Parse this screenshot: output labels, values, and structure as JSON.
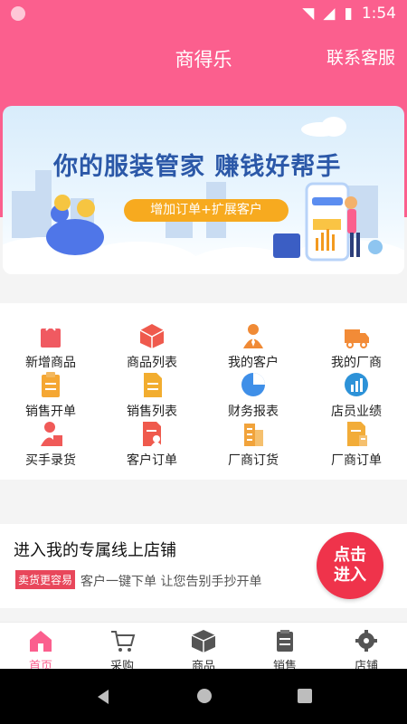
{
  "status_bar": {
    "time": "1:54"
  },
  "header": {
    "title": "商得乐",
    "service": "联系客服"
  },
  "banner": {
    "headline": "你的服装管家 赚钱好帮手",
    "pill": "增加订单+扩展客户"
  },
  "menu": [
    {
      "label": "新增商品",
      "icon": "shopping-bag-icon",
      "color": "#f05a61"
    },
    {
      "label": "商品列表",
      "icon": "package-icon",
      "color": "#ef5a4d"
    },
    {
      "label": "我的客户",
      "icon": "customer-icon",
      "color": "#f08a35"
    },
    {
      "label": "我的厂商",
      "icon": "truck-icon",
      "color": "#f28b37"
    },
    {
      "label": "销售开单",
      "icon": "clipboard-icon",
      "color": "#f5a733"
    },
    {
      "label": "销售列表",
      "icon": "document-icon",
      "color": "#f2ad2f"
    },
    {
      "label": "财务报表",
      "icon": "pie-chart-icon",
      "color": "#3f8fe8"
    },
    {
      "label": "店员业绩",
      "icon": "performance-chart-icon",
      "color": "#2d92d8"
    },
    {
      "label": "买手录货",
      "icon": "buyer-bag-icon",
      "color": "#f05a58"
    },
    {
      "label": "客户订单",
      "icon": "customer-order-icon",
      "color": "#ef5a4d"
    },
    {
      "label": "厂商订货",
      "icon": "vendor-building-icon",
      "color": "#f1a33b"
    },
    {
      "label": "厂商订单",
      "icon": "vendor-order-icon",
      "color": "#f2ac38"
    }
  ],
  "promo": {
    "title": "进入我的专属线上店铺",
    "tag": "卖货更容易",
    "description": "客户一键下单 让您告别手抄开单",
    "button": "点击进入"
  },
  "tabs": [
    {
      "label": "首页",
      "icon": "home-icon",
      "active": true
    },
    {
      "label": "采购",
      "icon": "cart-icon",
      "active": false
    },
    {
      "label": "商品",
      "icon": "box-icon",
      "active": false
    },
    {
      "label": "销售",
      "icon": "clipboard-icon",
      "active": false
    },
    {
      "label": "店铺",
      "icon": "gear-icon",
      "active": false
    }
  ]
}
